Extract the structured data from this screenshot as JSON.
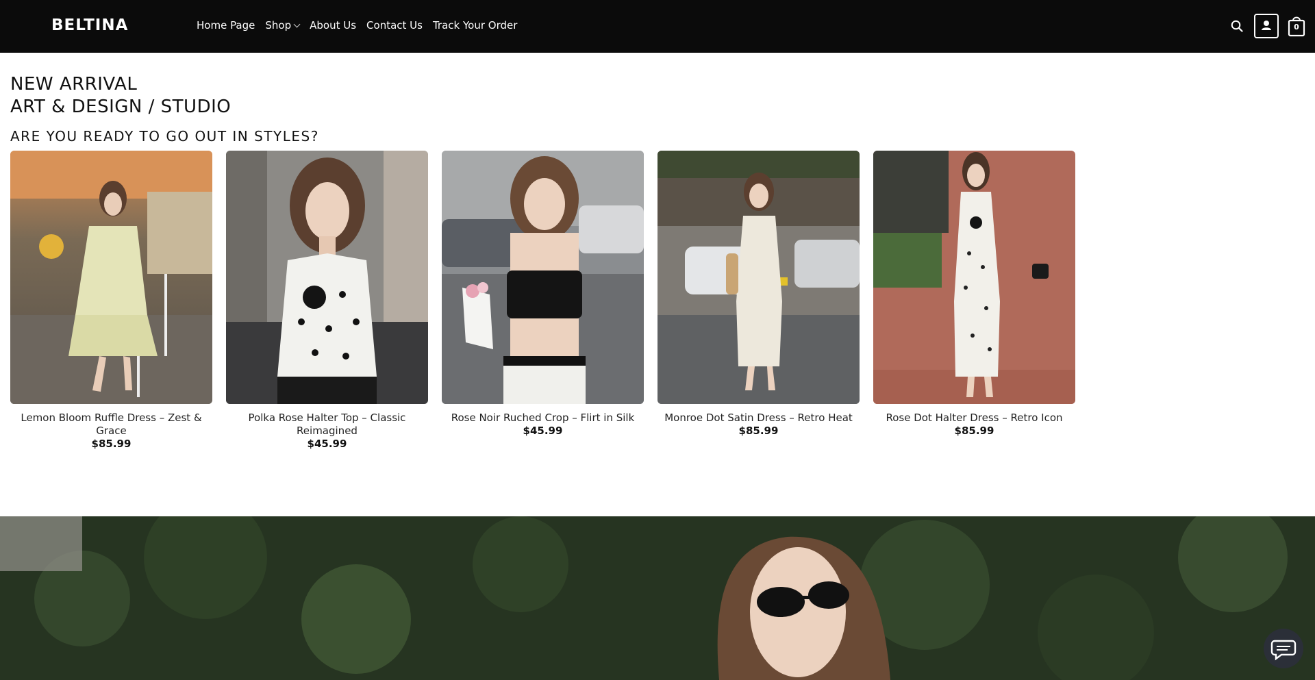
{
  "brand": {
    "logo_text": "BELTINA"
  },
  "nav": {
    "items": [
      {
        "label": "Home Page"
      },
      {
        "label": "Shop",
        "has_dropdown": true
      },
      {
        "label": "About Us"
      },
      {
        "label": "Contact Us"
      },
      {
        "label": "Track Your Order"
      }
    ]
  },
  "header_icons": {
    "search": "search-icon",
    "account": "user-icon",
    "cart": {
      "icon": "cart-icon",
      "count": "0"
    }
  },
  "hero": {
    "line1": "NEW ARRIVAL",
    "line2": "ART & DESIGN / STUDIO",
    "subtitle": "ARE YOU READY TO GO OUT IN STYLES?"
  },
  "products": [
    {
      "name": "Lemon Bloom Ruffle Dress – Zest & Grace",
      "price": "$85.99"
    },
    {
      "name": "Polka Rose Halter Top – Classic Reimagined",
      "price": "$45.99"
    },
    {
      "name": "Rose Noir Ruched Crop – Flirt in Silk",
      "price": "$45.99"
    },
    {
      "name": "Monroe Dot Satin Dress – Retro Heat",
      "price": "$85.99"
    },
    {
      "name": "Rose Dot Halter Dress – Retro Icon",
      "price": "$85.99"
    }
  ],
  "colors": {
    "header_bg": "#0b0b0b",
    "text": "#111111",
    "white": "#ffffff"
  },
  "chat": {
    "icon": "chat-icon"
  }
}
